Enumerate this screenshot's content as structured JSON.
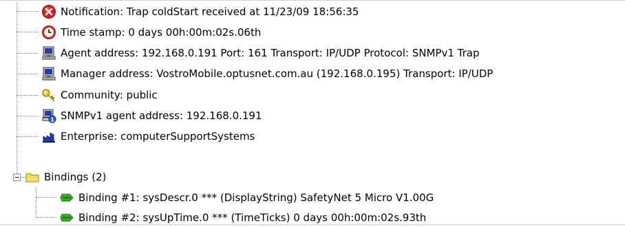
{
  "tree": {
    "items": [
      {
        "label": "Notification: Trap coldStart received at 11/23/09 18:56:35",
        "icon": "error-icon"
      },
      {
        "label": "Time stamp: 0 days 00h:00m:02s.06th",
        "icon": "clock-icon"
      },
      {
        "label": "Agent address: 192.168.0.191 Port: 161 Transport: IP/UDP Protocol: SNMPv1 Trap",
        "icon": "computer-icon"
      },
      {
        "label": "Manager address: VostroMobile.optusnet.com.au (192.168.0.195) Transport: IP/UDP",
        "icon": "computer-icon"
      },
      {
        "label": "Community: public",
        "icon": "key-icon"
      },
      {
        "label": "SNMPv1 agent address: 192.168.0.191",
        "icon": "agent-computer-icon"
      },
      {
        "label": "Enterprise: computerSupportSystems",
        "icon": "enterprise-icon"
      },
      {
        "label": "Bindings (2)",
        "icon": "folder-icon",
        "expanded": true
      },
      {
        "label": "Binding #1: sysDescr.0 *** (DisplayString) SafetyNet 5 Micro V1.00G",
        "icon": "binding-icon"
      },
      {
        "label": "Binding #2: sysUpTime.0 *** (TimeTicks) 0 days 00h:00m:02s.93th",
        "icon": "binding-icon"
      }
    ]
  }
}
